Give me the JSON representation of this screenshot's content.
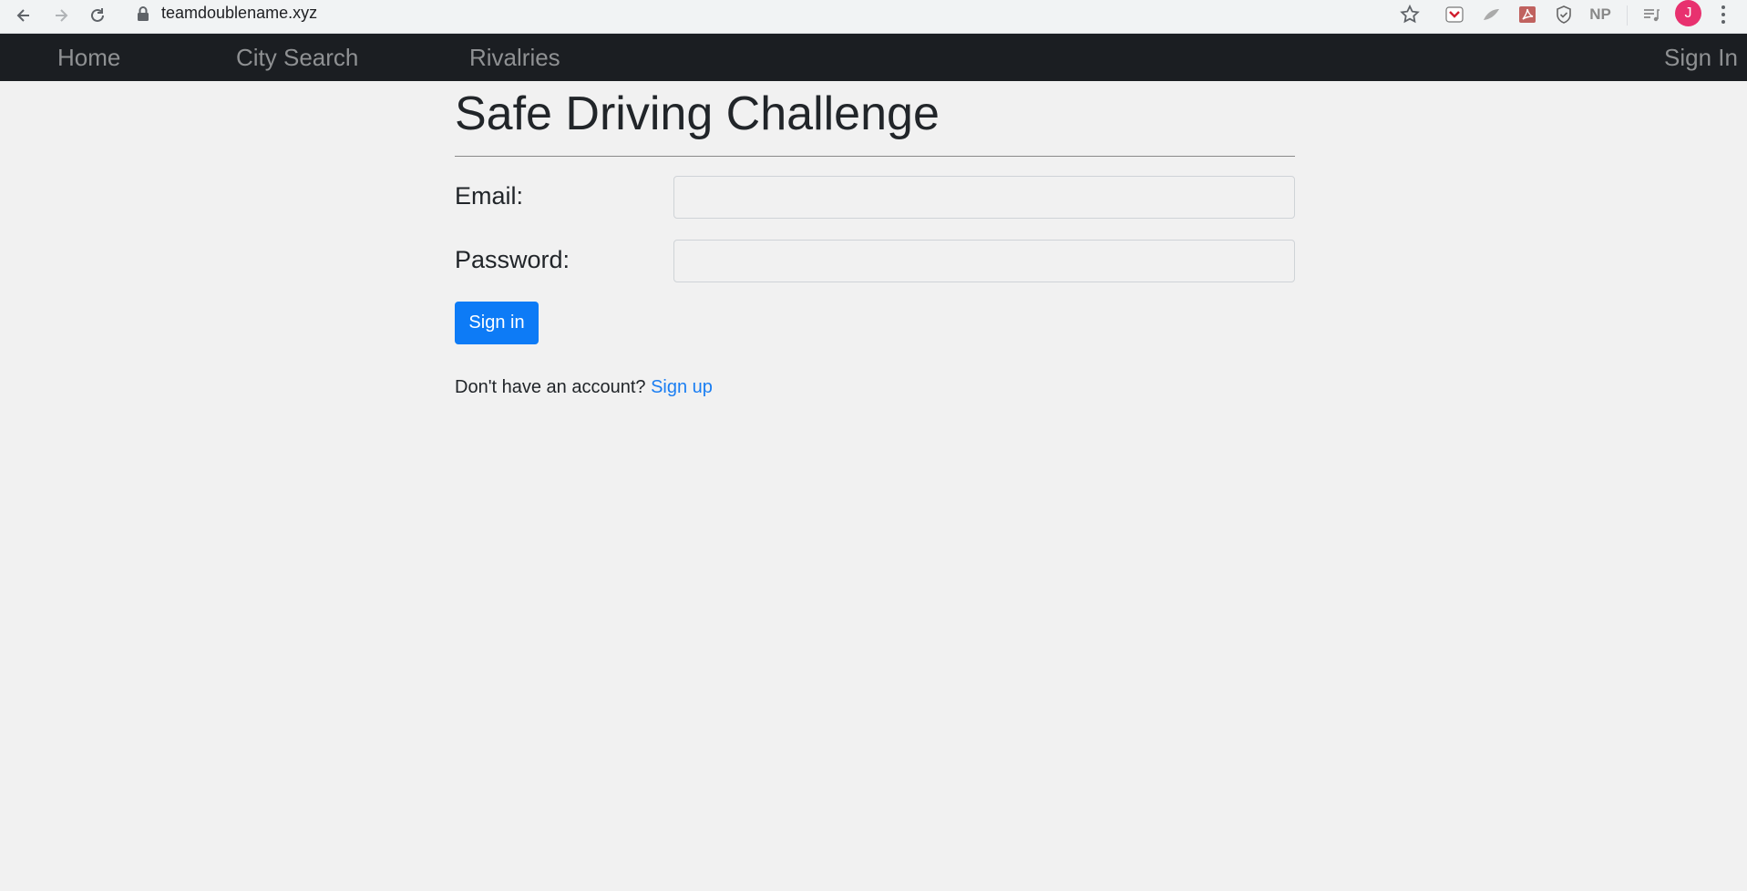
{
  "browser": {
    "url": "teamdoublename.xyz",
    "avatar_initial": "J",
    "extension_np_label": "NP"
  },
  "nav": {
    "home": "Home",
    "city_search": "City Search",
    "rivalries": "Rivalries",
    "sign_in": "Sign In"
  },
  "page": {
    "title": "Safe Driving Challenge",
    "email_label": "Email:",
    "email_value": "",
    "password_label": "Password:",
    "password_value": "",
    "signin_button": "Sign in",
    "no_account_text": "Don't have an account?",
    "signup_link": "Sign up"
  },
  "colors": {
    "navbar_bg": "#1b1e22",
    "primary": "#0d7bf6",
    "link": "#1a7ef2",
    "page_bg": "#f1f1f1"
  }
}
